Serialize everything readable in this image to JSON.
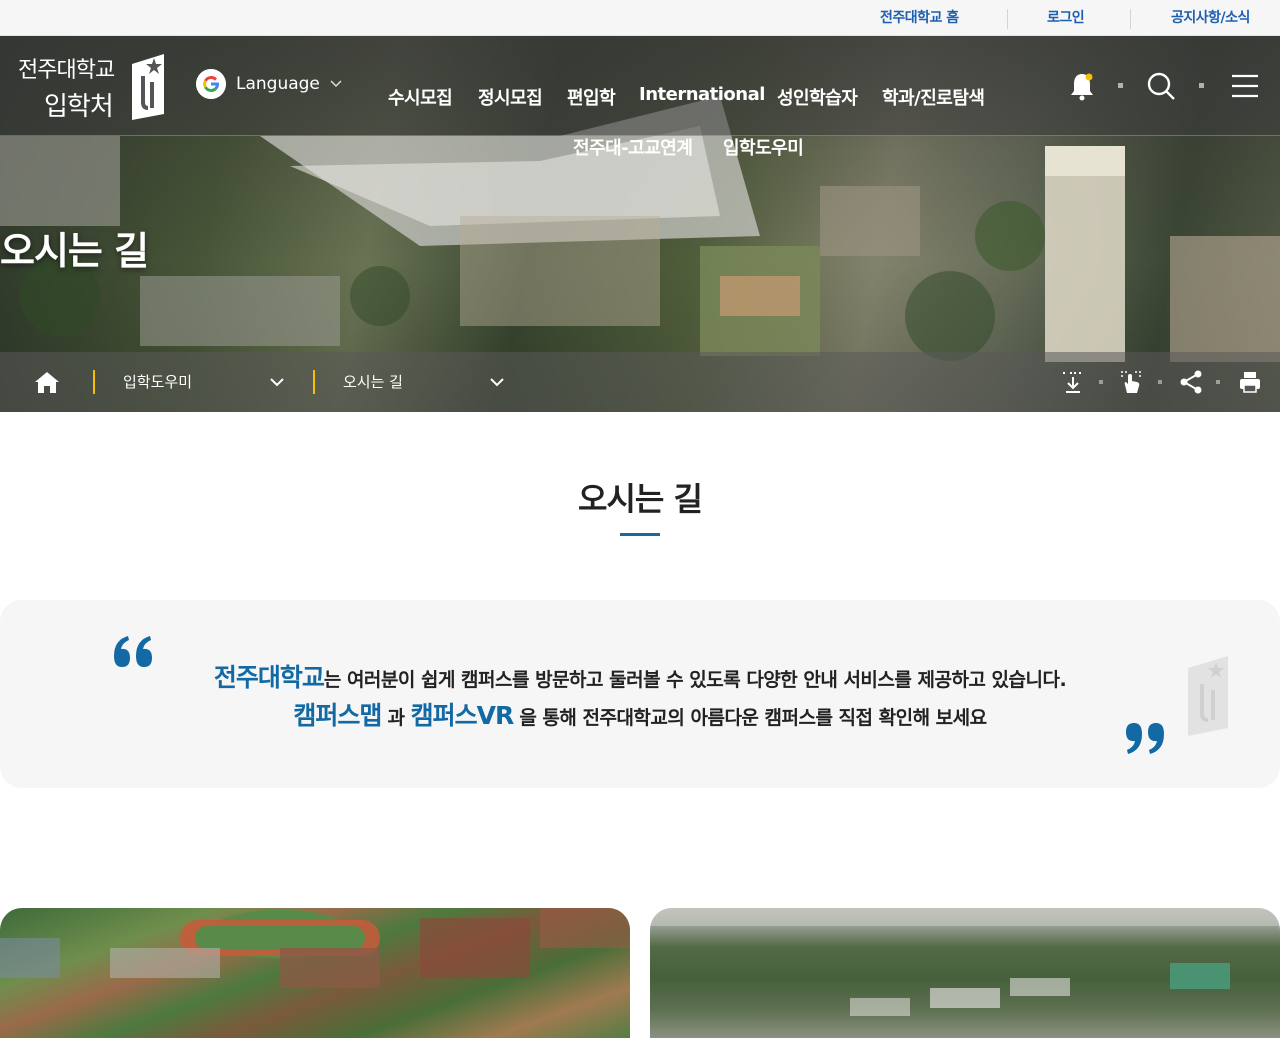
{
  "utility": {
    "home_link": "전주대학교 홈",
    "login_link": "로그인",
    "notice_link": "공지사항/소식"
  },
  "header": {
    "logo_line1": "전주대학교",
    "logo_line2": "입학처",
    "language_label": "Language",
    "nav": [
      {
        "label": "수시모집"
      },
      {
        "label": "정시모집"
      },
      {
        "label": "편입학"
      },
      {
        "label": "International"
      },
      {
        "label": "성인학습자"
      },
      {
        "label": "학과/진로탐색"
      },
      {
        "label": "전주대-고교연계"
      },
      {
        "label": "입학도우미"
      }
    ]
  },
  "hero": {
    "title": "오시는 길"
  },
  "breadcrumb": {
    "level1": "입학도우미",
    "level2": "오시는 길"
  },
  "content": {
    "section_title": "오시는 길",
    "quote": {
      "line1_highlight": "전주대학교",
      "line1_text": "는 여러분이 쉽게 캠퍼스를 방문하고 둘러볼 수 있도록 다양한 안내 서비스를 제공하고 있습니다.",
      "line2_highlight1": "캠퍼스맵",
      "line2_mid": " 과 ",
      "line2_highlight2": "캠퍼스VR",
      "line2_text": " 을 통해 전주대학교의 아름다운 캠퍼스를 직접 확인해 보세요"
    }
  },
  "colors": {
    "accent": "#1269a3",
    "util_link": "#1e5fb0",
    "breadcrumb_separator": "#f2c200",
    "notification_dot": "#f2c200"
  },
  "icons": [
    "google-logo-icon",
    "chevron-down-icon",
    "bell-icon",
    "search-icon",
    "menu-icon",
    "home-icon",
    "download-icon",
    "touch-icon",
    "share-icon",
    "print-icon",
    "quote-open-icon",
    "quote-close-icon"
  ]
}
